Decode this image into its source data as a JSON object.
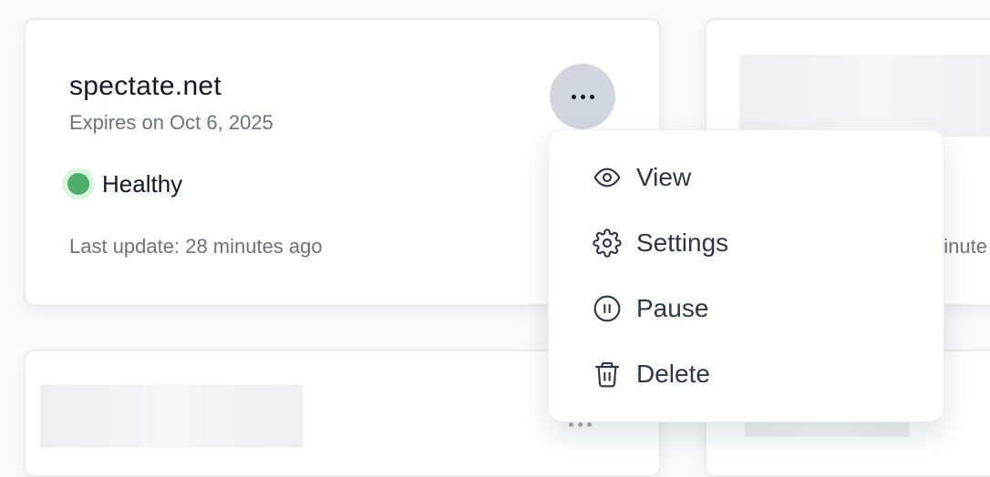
{
  "monitor": {
    "domain": "spectate.net",
    "expires": "Expires on Oct 6, 2025",
    "status": "Healthy",
    "status_color": "#4fae6b",
    "last_update": "Last update: 28 minutes ago"
  },
  "more_button": {
    "icon": "ellipsis-icon"
  },
  "menu": {
    "items": [
      {
        "label": "View",
        "icon": "eye-icon"
      },
      {
        "label": "Settings",
        "icon": "gear-icon"
      },
      {
        "label": "Pause",
        "icon": "pause-circle-icon"
      },
      {
        "label": "Delete",
        "icon": "trash-icon"
      }
    ]
  },
  "background_card": {
    "partial_text": "ninute"
  }
}
